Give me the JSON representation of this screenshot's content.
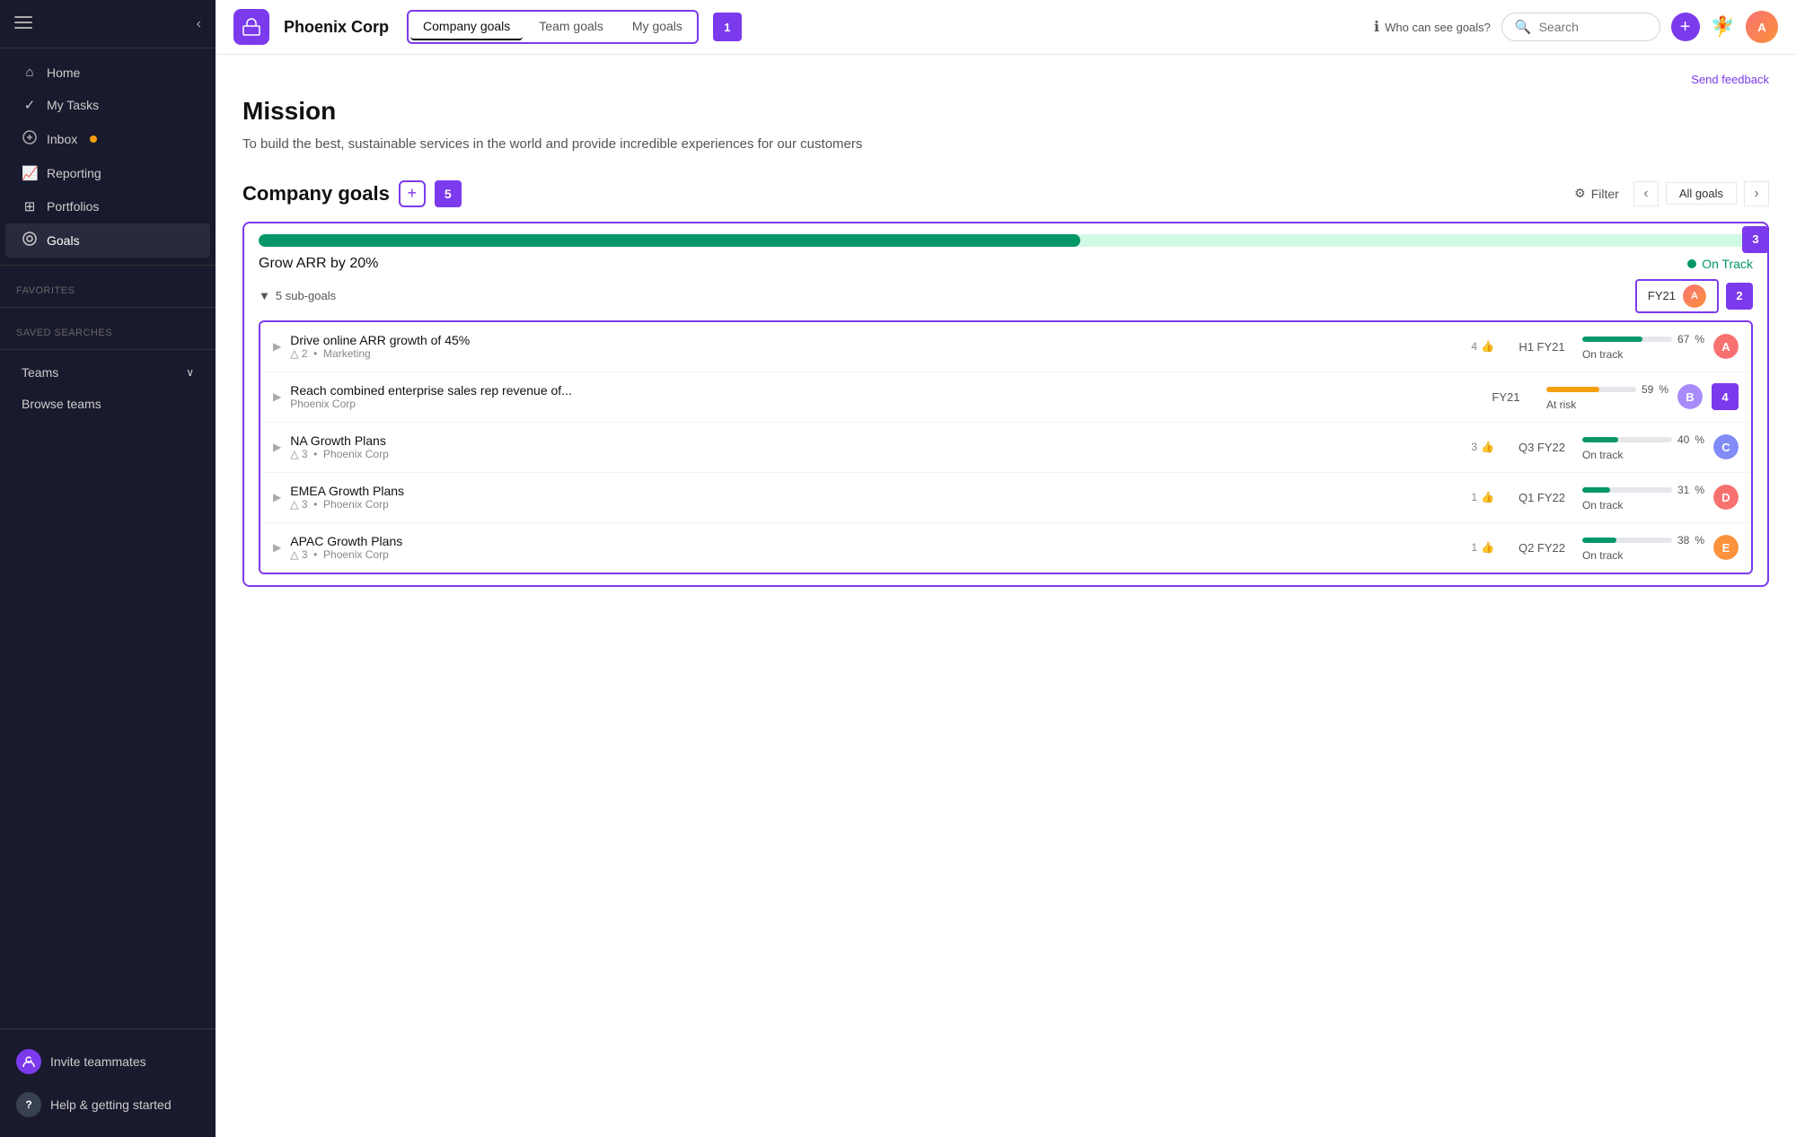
{
  "sidebar": {
    "toggle_icon": "≡",
    "nav_items": [
      {
        "label": "Home",
        "icon": "⌂",
        "active": false
      },
      {
        "label": "My Tasks",
        "icon": "✓",
        "active": false
      },
      {
        "label": "Inbox",
        "icon": "🔔",
        "active": false,
        "dot": true
      },
      {
        "label": "Reporting",
        "icon": "📈",
        "active": false
      },
      {
        "label": "Portfolios",
        "icon": "⊞",
        "active": false
      },
      {
        "label": "Goals",
        "icon": "👤",
        "active": true
      }
    ],
    "sections": {
      "favorites": "Favorites",
      "saved_searches": "Saved searches",
      "teams": "Teams",
      "browse_teams": "Browse teams"
    },
    "teams_chevron": "∨",
    "bottom": {
      "invite_label": "Invite teammates",
      "help_label": "Help & getting started"
    }
  },
  "header": {
    "company_icon": "🏢",
    "company_name": "Phoenix Corp",
    "tabs": [
      {
        "label": "Company goals",
        "active": true
      },
      {
        "label": "Team goals",
        "active": false
      },
      {
        "label": "My goals",
        "active": false
      }
    ],
    "badge_1": "1",
    "who_can_see": "Who can see goals?",
    "search_placeholder": "Search",
    "add_btn": "+",
    "notif_icon": "🧚"
  },
  "page": {
    "send_feedback": "Send feedback",
    "mission_title": "Mission",
    "mission_text": "To build the best, sustainable services in the world and provide incredible experiences for our customers",
    "company_goals_title": "Company goals",
    "add_btn_label": "+",
    "count_badge": "5",
    "filter_label": "Filter",
    "all_goals_label": "All goals",
    "main_goal": {
      "name": "Grow ARR by 20%",
      "status": "On Track",
      "progress_pct": 55,
      "sub_goals_count": "5 sub-goals",
      "period": "FY21",
      "badge_2": "2",
      "badge_3": "3",
      "badge_4": "4"
    },
    "sub_goals": [
      {
        "name": "Drive online ARR growth of 45%",
        "meta": "Marketing",
        "likes": "4",
        "warnings": "2",
        "period": "H1 FY21",
        "progress_pct": 67,
        "progress_type": "green",
        "status": "On track",
        "avatar_color": "#f87171"
      },
      {
        "name": "Reach combined enterprise sales rep revenue of...",
        "meta": "Phoenix Corp",
        "likes": "",
        "warnings": "",
        "period": "FY21",
        "progress_pct": 59,
        "progress_type": "yellow",
        "status": "At risk",
        "avatar_color": "#a78bfa"
      },
      {
        "name": "NA Growth Plans",
        "meta": "Phoenix Corp",
        "likes": "3",
        "warnings": "3",
        "period": "Q3 FY22",
        "progress_pct": 40,
        "progress_type": "green",
        "status": "On track",
        "avatar_color": "#818cf8"
      },
      {
        "name": "EMEA Growth Plans",
        "meta": "Phoenix Corp",
        "likes": "1",
        "warnings": "3",
        "period": "Q1 FY22",
        "progress_pct": 31,
        "progress_type": "green",
        "status": "On track",
        "avatar_color": "#f87171"
      },
      {
        "name": "APAC Growth Plans",
        "meta": "Phoenix Corp",
        "likes": "1",
        "warnings": "3",
        "period": "Q2 FY22",
        "progress_pct": 38,
        "progress_type": "green",
        "status": "On track",
        "avatar_color": "#fb923c"
      }
    ]
  }
}
